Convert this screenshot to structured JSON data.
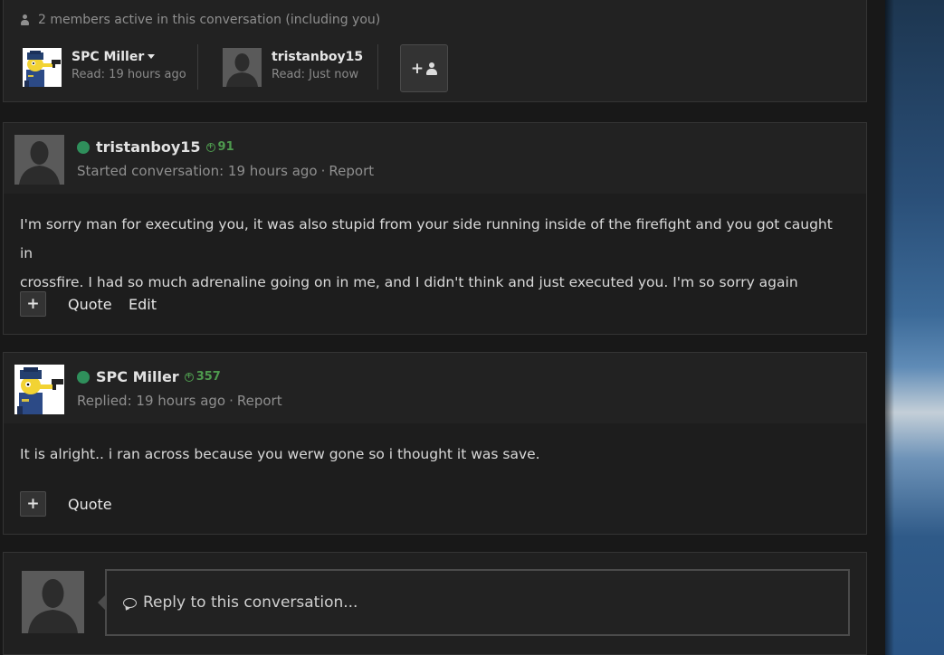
{
  "members": {
    "active_text": "2 members active in this conversation (including you)",
    "list": [
      {
        "name": "SPC Miller",
        "read": "Read: 19 hours ago",
        "has_menu": true
      },
      {
        "name": "tristanboy15",
        "read": "Read: Just now",
        "has_menu": false
      }
    ],
    "add_button_icon": "add-member-icon"
  },
  "messages": [
    {
      "author": "tristanboy15",
      "reputation": "91",
      "online": true,
      "meta": "Started conversation: 19 hours ago",
      "report_label": "Report",
      "text_lines": [
        "I'm sorry man for executing you, it was also stupid from your side running inside of the firefight and you got caught in",
        "crossfire. I had so much adrenaline going on in me, and I didn't think and just executed you. I'm so sorry again"
      ],
      "plus_label": "+",
      "quote_label": "Quote",
      "edit_label": "Edit"
    },
    {
      "author": "SPC Miller",
      "reputation": "357",
      "online": true,
      "meta": "Replied: 19 hours ago",
      "report_label": "Report",
      "text_lines": [
        "It is alright.. i ran across because you werw gone so i thought it was save."
      ],
      "plus_label": "+",
      "quote_label": "Quote"
    }
  ],
  "reply": {
    "placeholder": "Reply to this conversation..."
  },
  "colors": {
    "online": "#2f8f5b",
    "reputation": "#4e9a4e",
    "panel": "#222222"
  }
}
